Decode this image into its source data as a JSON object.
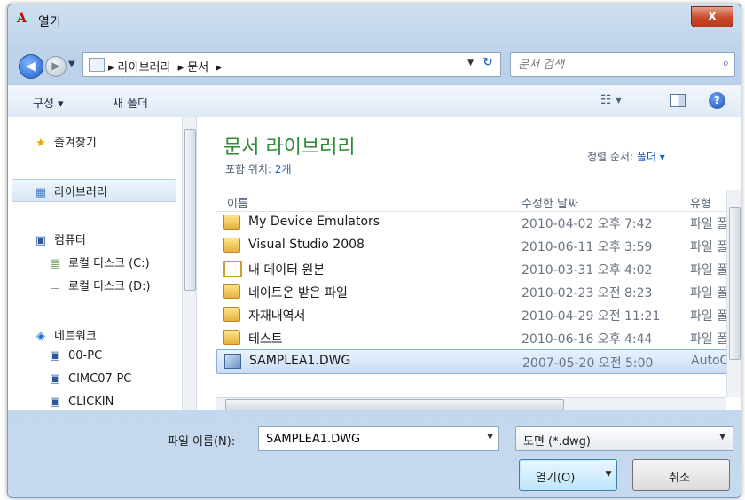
{
  "window": {
    "title": "열기",
    "app_icon": "A",
    "close_label": "x"
  },
  "nav": {
    "back_glyph": "◀",
    "forward_glyph": "▶",
    "dropdown_glyph": "▼"
  },
  "address": {
    "crumbs": [
      "▸ 라이브러리",
      "▸ 문서",
      "▸"
    ],
    "dropdown_glyph": "▼",
    "refresh_glyph": "↻"
  },
  "search": {
    "placeholder": "문서 검색",
    "icon": "⌕"
  },
  "toolbar": {
    "organize": "구성 ▾",
    "new_folder": "새 폴더",
    "views_glyph": "☷ ▾",
    "help_glyph": "?"
  },
  "sidebar": {
    "items": [
      {
        "icon": "★",
        "label": "즐겨찾기"
      },
      {
        "icon": "▦",
        "label": "라이브러리"
      },
      {
        "icon": "▣",
        "label": "컴퓨터"
      },
      {
        "icon": "▤",
        "label": "로컬 디스크 (C:)"
      },
      {
        "icon": "▭",
        "label": "로컬 디스크 (D:)"
      },
      {
        "icon": "◈",
        "label": "네트워크"
      },
      {
        "icon": "▣",
        "label": "00-PC"
      },
      {
        "icon": "▣",
        "label": "CIMC07-PC"
      },
      {
        "icon": "▣",
        "label": "CLICKIN"
      }
    ]
  },
  "library": {
    "title": "문서 라이브러리",
    "include_label": "포함 위치:",
    "include_value": "2개",
    "sort_label": "정렬 순서:",
    "sort_value": "폴더 ▾"
  },
  "columns": {
    "name": "이름",
    "date": "수정한 날짜",
    "type": "유형"
  },
  "files": [
    {
      "name": "My Device Emulators",
      "date": "2010-04-02 오후 7:42",
      "type": "파일 폴",
      "icon": "folder"
    },
    {
      "name": "Visual Studio 2008",
      "date": "2010-06-11 오후 3:59",
      "type": "파일 폴",
      "icon": "folder"
    },
    {
      "name": "내 데이터 원본",
      "date": "2010-03-31 오후 4:02",
      "type": "파일 폴",
      "icon": "picfolder"
    },
    {
      "name": "네이트온 받은 파일",
      "date": "2010-02-23 오전 8:23",
      "type": "파일 폴",
      "icon": "folder"
    },
    {
      "name": "자재내역서",
      "date": "2010-04-29 오전 11:21",
      "type": "파일 폴",
      "icon": "folder"
    },
    {
      "name": "테스트",
      "date": "2010-06-16 오후 4:44",
      "type": "파일 폴",
      "icon": "folder"
    },
    {
      "name": "SAMPLEA1.DWG",
      "date": "2007-05-20 오전 5:00",
      "type": "AutoC",
      "icon": "dwg",
      "selected": true
    }
  ],
  "footer": {
    "filename_label": "파일 이름(N):",
    "filename_value": "SAMPLEA1.DWG",
    "filetype_value": "도면 (*.dwg)",
    "open_label": "열기(O)",
    "cancel_label": "취소"
  }
}
